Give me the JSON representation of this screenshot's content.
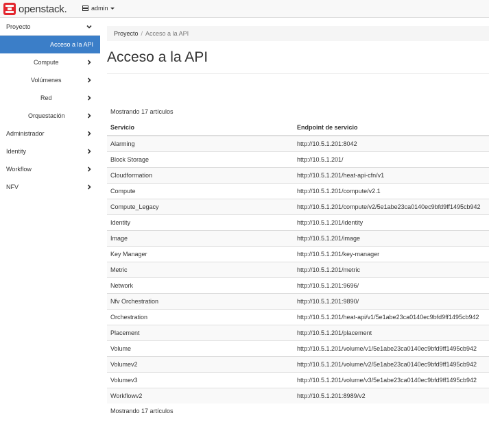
{
  "brand": {
    "name": "openstack.",
    "color": "#e3262e"
  },
  "header": {
    "project_menu_label": "admin"
  },
  "sidebar": {
    "items": [
      {
        "label": "Proyecto",
        "chevron": "down"
      },
      {
        "label": "Acceso a la API",
        "active": true
      },
      {
        "label": "Compute",
        "chevron": "right"
      },
      {
        "label": "Volúmenes",
        "chevron": "right"
      },
      {
        "label": "Red",
        "chevron": "right"
      },
      {
        "label": "Orquestación",
        "chevron": "right"
      },
      {
        "label": "Administrador",
        "chevron": "right"
      },
      {
        "label": "Identity",
        "chevron": "right"
      },
      {
        "label": "Workflow",
        "chevron": "right"
      },
      {
        "label": "NFV",
        "chevron": "right"
      }
    ],
    "active_color": "#3b7ec8"
  },
  "breadcrumb": {
    "items": [
      "Proyecto",
      "Acceso a la API"
    ]
  },
  "page": {
    "title": "Acceso a la API"
  },
  "table": {
    "count_top": "Mostrando 17 artículos",
    "count_bottom": "Mostrando 17 artículos",
    "headers": [
      "Servicio",
      "Endpoint de servicio"
    ],
    "rows": [
      [
        "Alarming",
        "http://10.5.1.201:8042"
      ],
      [
        "Block Storage",
        "http://10.5.1.201/"
      ],
      [
        "Cloudformation",
        "http://10.5.1.201/heat-api-cfn/v1"
      ],
      [
        "Compute",
        "http://10.5.1.201/compute/v2.1"
      ],
      [
        "Compute_Legacy",
        "http://10.5.1.201/compute/v2/5e1abe23ca0140ec9bfd9ff1495cb942"
      ],
      [
        "Identity",
        "http://10.5.1.201/identity"
      ],
      [
        "Image",
        "http://10.5.1.201/image"
      ],
      [
        "Key Manager",
        "http://10.5.1.201/key-manager"
      ],
      [
        "Metric",
        "http://10.5.1.201/metric"
      ],
      [
        "Network",
        "http://10.5.1.201:9696/"
      ],
      [
        "Nfv Orchestration",
        "http://10.5.1.201:9890/"
      ],
      [
        "Orchestration",
        "http://10.5.1.201/heat-api/v1/5e1abe23ca0140ec9bfd9ff1495cb942"
      ],
      [
        "Placement",
        "http://10.5.1.201/placement"
      ],
      [
        "Volume",
        "http://10.5.1.201/volume/v1/5e1abe23ca0140ec9bfd9ff1495cb942"
      ],
      [
        "Volumev2",
        "http://10.5.1.201/volume/v2/5e1abe23ca0140ec9bfd9ff1495cb942"
      ],
      [
        "Volumev3",
        "http://10.5.1.201/volume/v3/5e1abe23ca0140ec9bfd9ff1495cb942"
      ],
      [
        "Workflowv2",
        "http://10.5.1.201:8989/v2"
      ]
    ]
  }
}
